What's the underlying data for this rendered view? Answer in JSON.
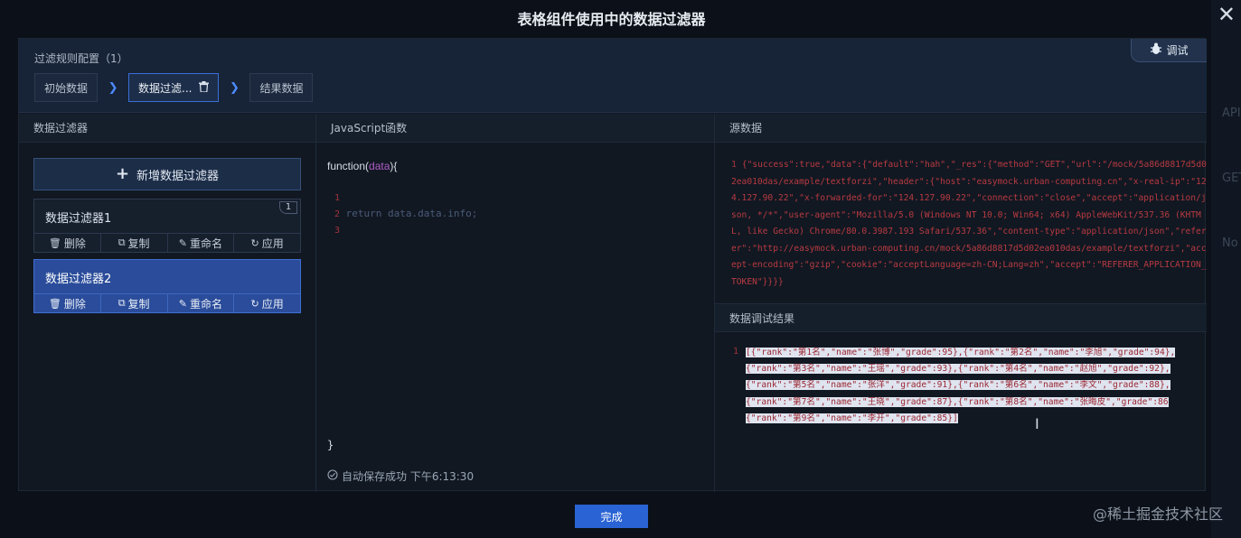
{
  "modal": {
    "title": "表格组件使用中的数据过滤器",
    "close_glyph": "✕",
    "done_label": "完成"
  },
  "config": {
    "title": "过滤规则配置（1）",
    "debug_label": "调试",
    "steps": [
      {
        "label": "初始数据"
      },
      {
        "label": "数据过滤..."
      },
      {
        "label": "结果数据"
      }
    ]
  },
  "filters_panel": {
    "header": "数据过滤器",
    "add_label": "新增数据过滤器",
    "items": [
      {
        "name": "数据过滤器1",
        "badge": "1"
      },
      {
        "name": "数据过滤器2",
        "badge": ""
      }
    ],
    "actions": {
      "delete": "删除",
      "copy": "复制",
      "rename": "重命名",
      "apply": "应用"
    }
  },
  "js_panel": {
    "header": "JavaScript函数",
    "signature_prefix": "function(",
    "signature_param": "data",
    "signature_suffix": "){",
    "line_numbers": [
      "1",
      "2",
      "3"
    ],
    "code_line_2": "return data.data.info;",
    "closing": "}",
    "autosave": "自动保存成功 下午6:13:30"
  },
  "source_panel": {
    "header": "源数据",
    "line_number": "1",
    "text": "{\"success\":true,\"data\":{\"default\":\"hah\",\"_res\":{\"method\":\"GET\",\"url\":\"/mock/5a86d8817d5d02ea010das/example/textforzi\",\"header\":{\"host\":\"easymock.urban-computing.cn\",\"x-real-ip\":\"124.127.90.22\",\"x-forwarded-for\":\"124.127.90.22\",\"connection\":\"close\",\"accept\":\"application/json, */*\",\"user-agent\":\"Mozilla/5.0 (Windows NT 10.0; Win64; x64) AppleWebKit/537.36 (KHTML, like Gecko) Chrome/80.0.3987.193 Safari/537.36\",\"content-type\":\"application/json\",\"referer\":\"http://easymock.urban-computing.cn/mock/5a86d8817d5d02ea010das/example/textforzi\",\"accept-encoding\":\"gzip\",\"cookie\":\"acceptLanguage=zh-CN;Lang=zh\",\"accept\":\"REFERER_APPLICATION_TOKEN\"}}}}",
    "result_header": "数据调试结果",
    "result_line_number": "1",
    "result_lines": [
      "[{\"rank\":\"第1名\",\"name\":\"张博\",\"grade\":95},{\"rank\":\"第2名\",\"name\":\"李旭\",\"grade\":94},",
      "{\"rank\":\"第3名\",\"name\":\"王瑶\",\"grade\":93},{\"rank\":\"第4名\",\"name\":\"赵旭\",\"grade\":92},",
      "{\"rank\":\"第5名\",\"name\":\"张洋\",\"grade\":91},{\"rank\":\"第6名\",\"name\":\"李文\",\"grade\":88},",
      "{\"rank\":\"第7名\",\"name\":\"王晓\",\"grade\":87},{\"rank\":\"第8名\",\"name\":\"张晦皮\",\"grade\":86",
      "{\"rank\":\"第9名\",\"name\":\"李开\",\"grade\":85}]"
    ]
  },
  "background": {
    "side_texts": [
      "API",
      "GET",
      "No"
    ]
  },
  "watermark": "@稀土掘金技术社区",
  "colors": {
    "accent": "#2a63d4",
    "step_arrow": "#4d8bff",
    "code_red": "#b93a41",
    "param_purple": "#b05cc8"
  }
}
